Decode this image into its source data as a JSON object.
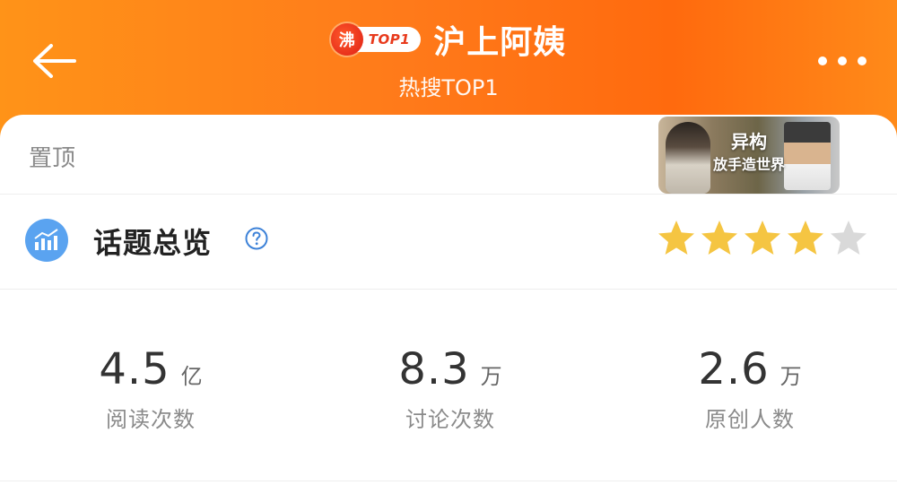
{
  "header": {
    "badge_boil": "沸",
    "badge_top": "TOP1",
    "title": "沪上阿姨",
    "subtitle": "热搜TOP1",
    "back_icon": "arrow-left-icon",
    "more_icon": "more-dots-icon"
  },
  "pinned": {
    "label": "置顶",
    "promo": {
      "line1": "异构",
      "line2": "放手造世界"
    }
  },
  "overview": {
    "title": "话题总览",
    "icon": "bar-chart-icon",
    "help_icon": "question-circle-icon",
    "rating": 4,
    "rating_max": 5,
    "star_color_on": "#f5c542",
    "star_color_off": "#d9d9d9"
  },
  "stats": [
    {
      "value": "4.5",
      "unit": "亿",
      "label": "阅读次数"
    },
    {
      "value": "8.3",
      "unit": "万",
      "label": "讨论次数"
    },
    {
      "value": "2.6",
      "unit": "万",
      "label": "原创人数"
    }
  ]
}
